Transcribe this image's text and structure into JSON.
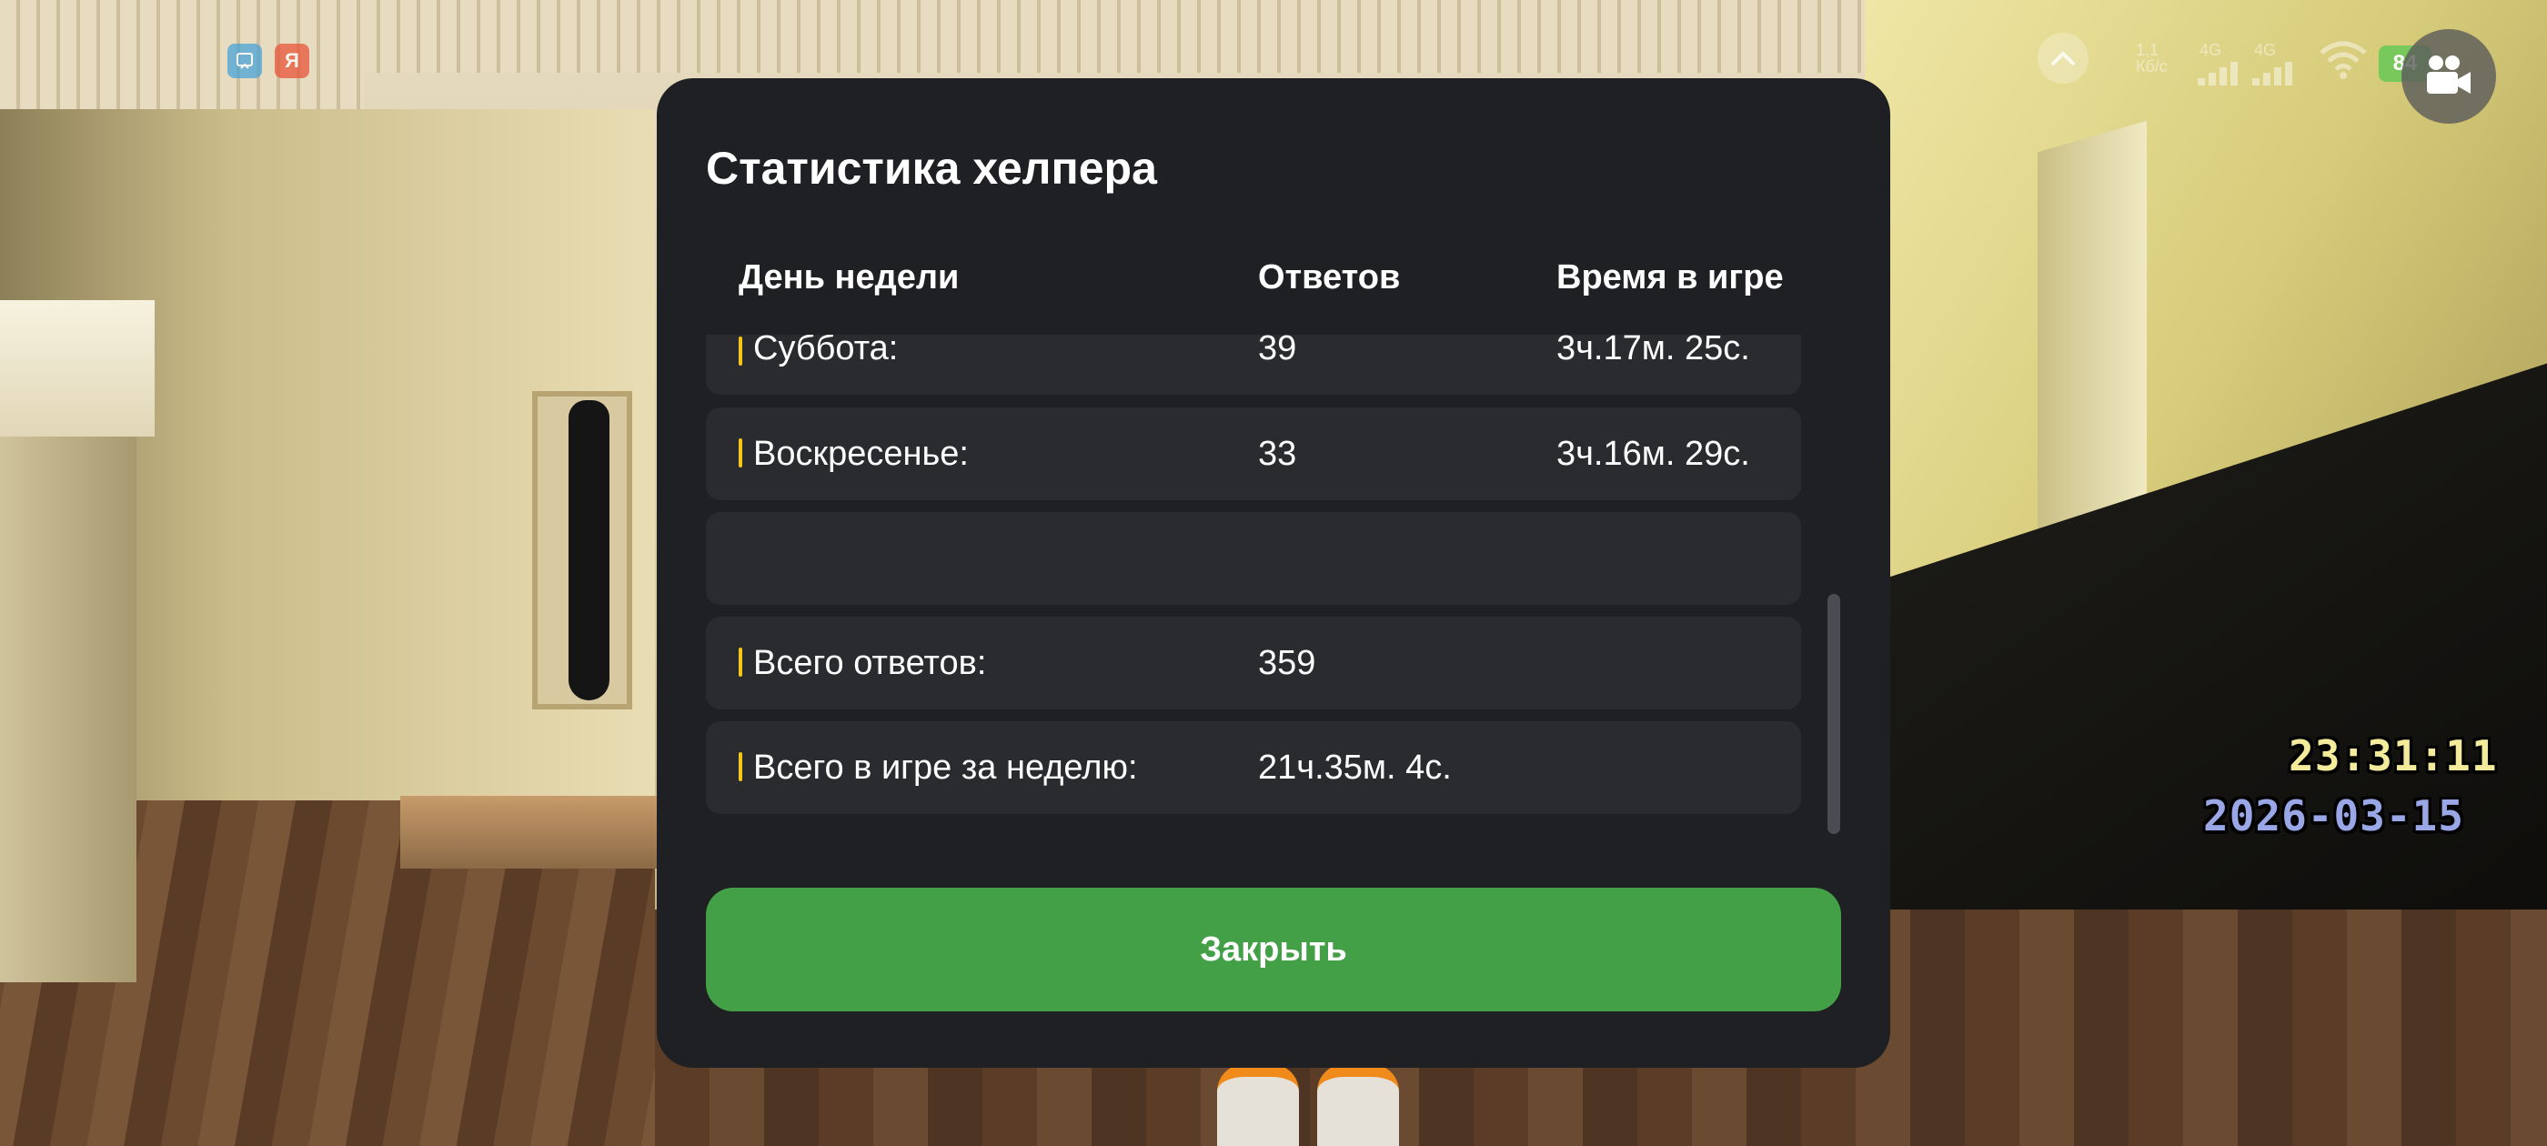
{
  "modal": {
    "title": "Статистика хелпера",
    "columns": [
      "День недели",
      "Ответов",
      "Время в игре"
    ],
    "rows": [
      {
        "day": "Суббота:",
        "answers": "39",
        "time": "3ч.17м. 25с."
      },
      {
        "day": "Воскресенье:",
        "answers": "33",
        "time": "3ч.16м. 29с."
      },
      {
        "day": "",
        "answers": "",
        "time": ""
      },
      {
        "day": "Всего ответов:",
        "answers": "359",
        "time": ""
      },
      {
        "day": "Всего в игре за неделю:",
        "answers": "21ч.35м. 4с.",
        "time": ""
      }
    ],
    "close_label": "Закрыть",
    "accent_color": "#f5c518",
    "button_color": "#43a047"
  },
  "hud": {
    "time": "23:31:11",
    "date": "2026-03-15"
  },
  "statusbar": {
    "net_speed": "1,1",
    "net_unit": "Кб/с",
    "sim1": "4G",
    "sim2": "4G",
    "battery": "84"
  },
  "top_icons": [
    "translate-app-icon",
    "yandex-icon"
  ],
  "top_icon_letter": "Я"
}
